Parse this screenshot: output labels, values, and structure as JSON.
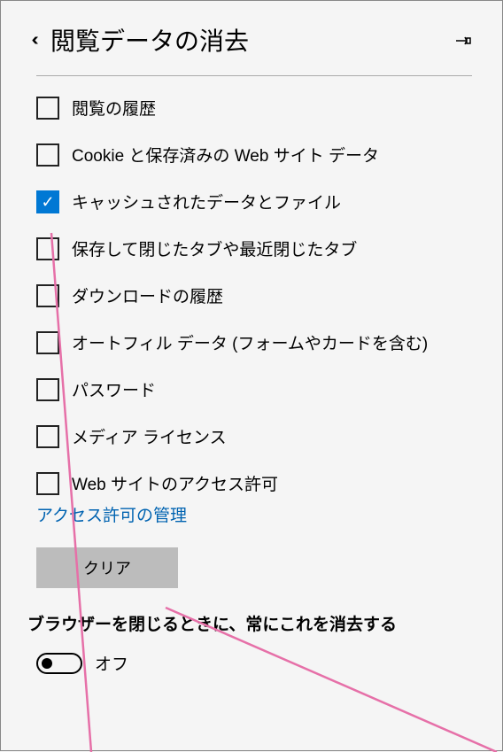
{
  "header": {
    "title": "閲覧データの消去"
  },
  "options": [
    {
      "label": "閲覧の履歴",
      "checked": false
    },
    {
      "label": "Cookie と保存済みの Web サイト データ",
      "checked": false
    },
    {
      "label": "キャッシュされたデータとファイル",
      "checked": true
    },
    {
      "label": "保存して閉じたタブや最近閉じたタブ",
      "checked": false
    },
    {
      "label": "ダウンロードの履歴",
      "checked": false
    },
    {
      "label": "オートフィル データ (フォームやカードを含む)",
      "checked": false
    },
    {
      "label": "パスワード",
      "checked": false
    },
    {
      "label": "メディア ライセンス",
      "checked": false
    },
    {
      "label": "Web サイトのアクセス許可",
      "checked": false
    }
  ],
  "permissions_link": "アクセス許可の管理",
  "clear_button": "クリア",
  "section_heading": "ブラウザーを閉じるときに、常にこれを消去する",
  "toggle": {
    "state": false,
    "label": "オフ"
  }
}
